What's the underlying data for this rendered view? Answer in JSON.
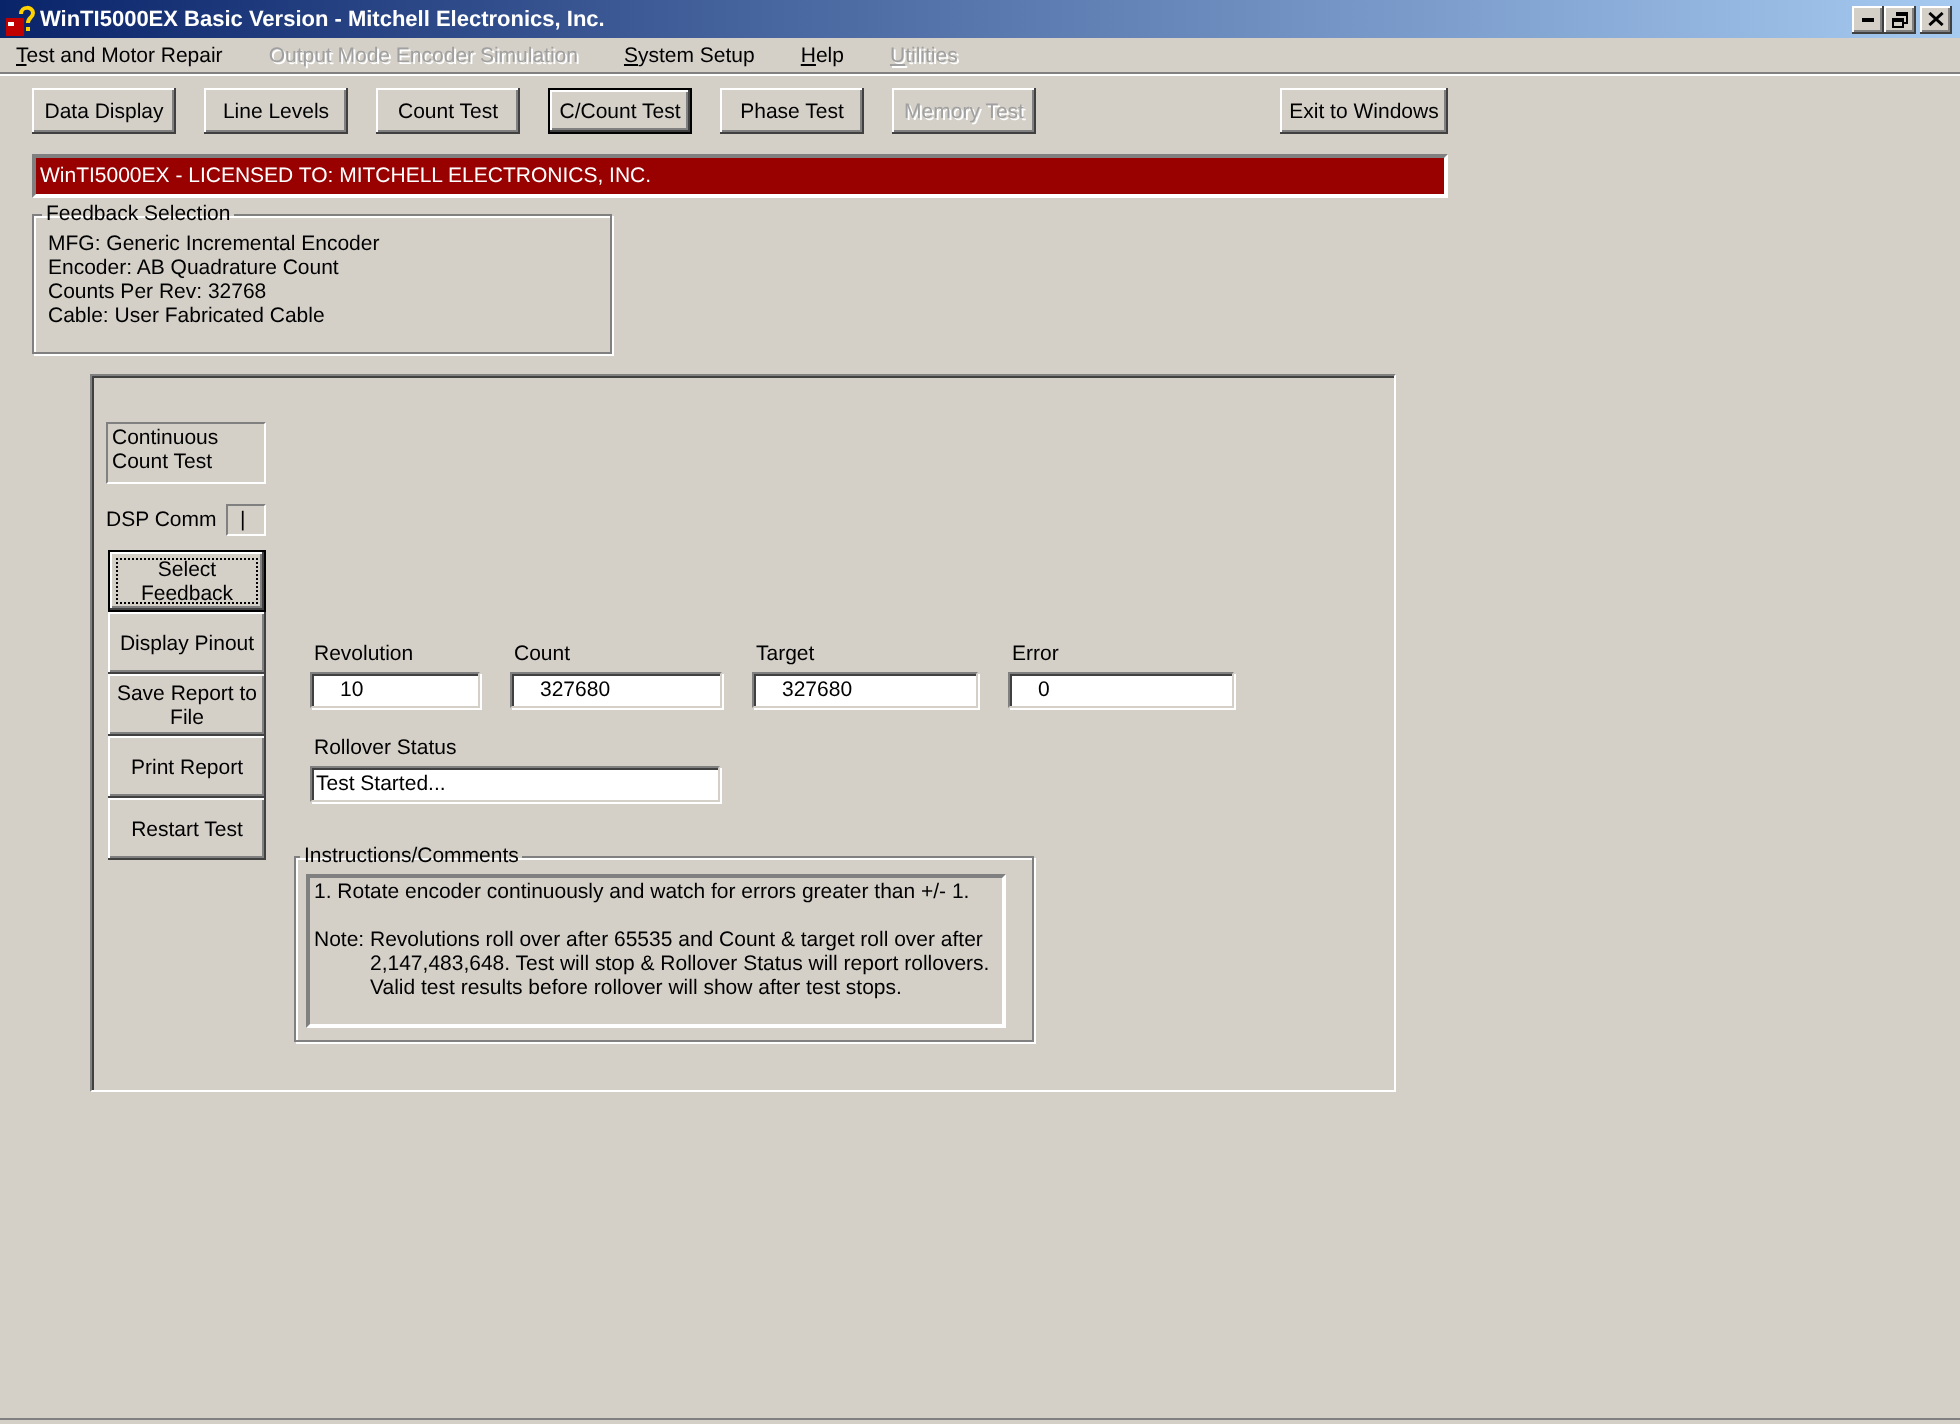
{
  "window": {
    "title": "WinTI5000EX Basic Version - Mitchell Electronics, Inc.",
    "maximized": true
  },
  "menu": [
    {
      "label": "Test and Motor Repair",
      "disabled": false,
      "mnemonic": true
    },
    {
      "label": "Output Mode Encoder Simulation",
      "disabled": true,
      "mnemonic": false
    },
    {
      "label": "System Setup",
      "disabled": false,
      "mnemonic": true
    },
    {
      "label": "Help",
      "disabled": false,
      "mnemonic": true
    },
    {
      "label": "Utilities",
      "disabled": true,
      "mnemonic": true
    }
  ],
  "toolbar": [
    {
      "label": "Data Display",
      "selected": false,
      "disabled": false
    },
    {
      "label": "Line Levels",
      "selected": false,
      "disabled": false
    },
    {
      "label": "Count Test",
      "selected": false,
      "disabled": false
    },
    {
      "label": "C/Count Test",
      "selected": true,
      "disabled": false
    },
    {
      "label": "Phase Test",
      "selected": false,
      "disabled": false
    },
    {
      "label": "Memory Test",
      "selected": false,
      "disabled": true
    }
  ],
  "exit_button": {
    "label": "Exit to Windows"
  },
  "license_banner": "WinTI5000EX - LICENSED TO: MITCHELL ELECTRONICS, INC.",
  "feedback_selection": {
    "title": "Feedback Selection",
    "lines": [
      "MFG: Generic Incremental Encoder",
      "Encoder: AB Quadrature Count",
      "Counts Per Rev: 32768",
      "Cable: User Fabricated Cable"
    ]
  },
  "test_panel": {
    "test_name": "Continuous Count Test",
    "dsp_comm": {
      "label": "DSP Comm",
      "value": "|"
    },
    "buttons": [
      {
        "label": "Select Feedback",
        "focused": true
      },
      {
        "label": "Display Pinout",
        "focused": false
      },
      {
        "label": "Save Report to File",
        "focused": false
      },
      {
        "label": "Print Report",
        "focused": false
      },
      {
        "label": "Restart Test",
        "focused": false
      }
    ],
    "readings": [
      {
        "label": "Revolution",
        "value": "10"
      },
      {
        "label": "Count",
        "value": "327680"
      },
      {
        "label": "Target",
        "value": "327680"
      },
      {
        "label": "Error",
        "value": "0"
      }
    ],
    "rollover_status": {
      "label": "Rollover Status",
      "value": "Test Started..."
    },
    "instructions": {
      "title": "Instructions/Comments",
      "paragraphs": [
        {
          "kind": "step",
          "text": "1. Rotate encoder continuously and watch for errors greater than +/- 1."
        },
        {
          "kind": "note",
          "text": "Note: Revolutions roll over after 65535 and Count & target roll over after 2,147,483,648. Test will stop & Rollover Status will report rollovers. Valid test results before rollover will show after test stops."
        }
      ]
    }
  }
}
